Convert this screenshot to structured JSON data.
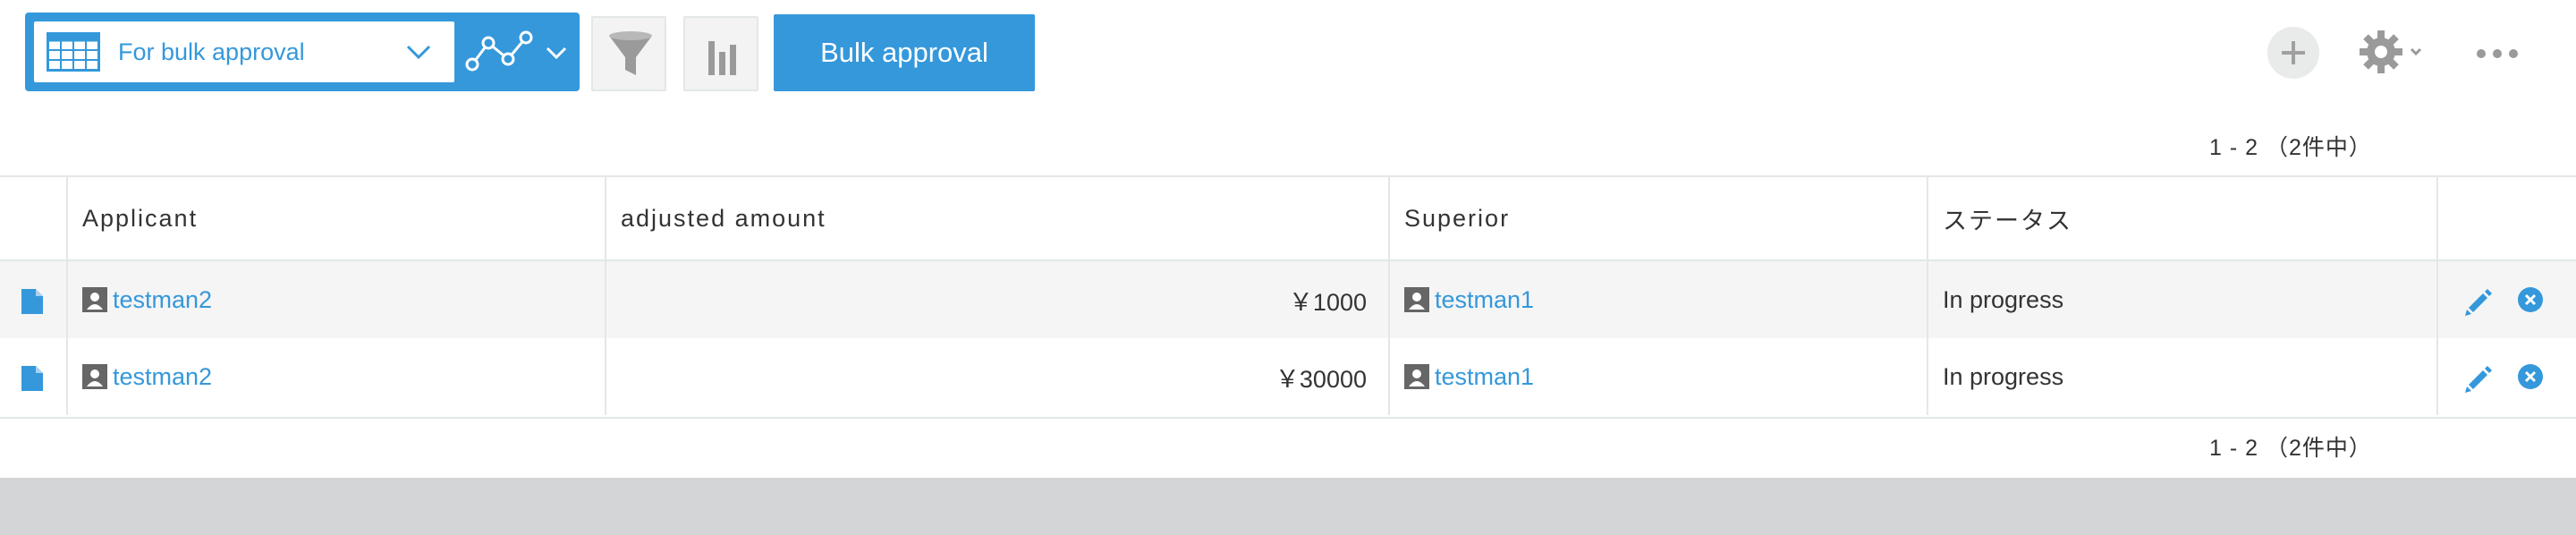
{
  "toolbar": {
    "view_name": "For bulk approval",
    "bulk_approval_label": "Bulk approval",
    "icons": {
      "view": "table-grid-icon",
      "view_dropdown": "chevron-down-icon",
      "graph": "graph-line-icon",
      "graph_dropdown": "chevron-down-icon",
      "filter": "filter-funnel-icon",
      "chart": "bar-chart-icon",
      "add": "plus-icon",
      "settings": "gear-icon",
      "more": "ellipsis-icon"
    }
  },
  "pagination": {
    "top": "1 - 2 （2件中）",
    "bottom": "1 - 2 （2件中）"
  },
  "table": {
    "columns": [
      "Applicant",
      "adjusted amount",
      "Superior",
      "ステータス"
    ],
    "rows": [
      {
        "applicant": "testman2",
        "amount": "￥1000",
        "superior": "testman1",
        "status": "In progress"
      },
      {
        "applicant": "testman2",
        "amount": "￥30000",
        "superior": "testman1",
        "status": "In progress"
      }
    ]
  },
  "colors": {
    "accent": "#3498db",
    "border": "#e3e7e8",
    "row_stripe": "#f5f5f5",
    "footer": "#d4d5d6",
    "text": "#333333"
  }
}
